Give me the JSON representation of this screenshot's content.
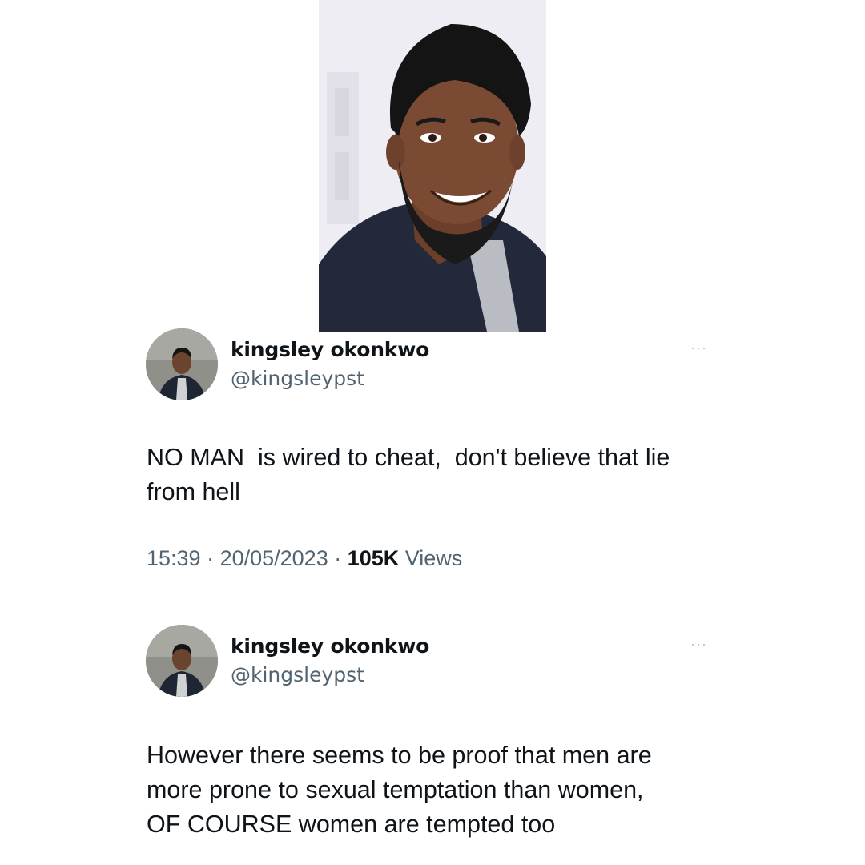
{
  "photo": {
    "icon": "person-portrait-photo"
  },
  "tweets": [
    {
      "author_name": "kingsley okonkwo",
      "author_handle": "@kingsleypst",
      "more_label": "···",
      "text": "NO MAN  is wired to cheat,  don't believe that lie\nfrom hell",
      "time": "15:39",
      "sep1": " · ",
      "date": "20/05/2023",
      "sep2": " · ",
      "views_count": "105K",
      "views_label": " Views"
    },
    {
      "author_name": "kingsley okonkwo",
      "author_handle": "@kingsleypst",
      "more_label": "···",
      "text": "However there seems to be proof that men are\nmore prone to sexual temptation than women,\nOF COURSE women are tempted too"
    }
  ],
  "colors": {
    "text_primary": "#0f1419",
    "text_secondary": "#536471",
    "more_icon": "#b9c1c8",
    "background": "#ffffff"
  }
}
